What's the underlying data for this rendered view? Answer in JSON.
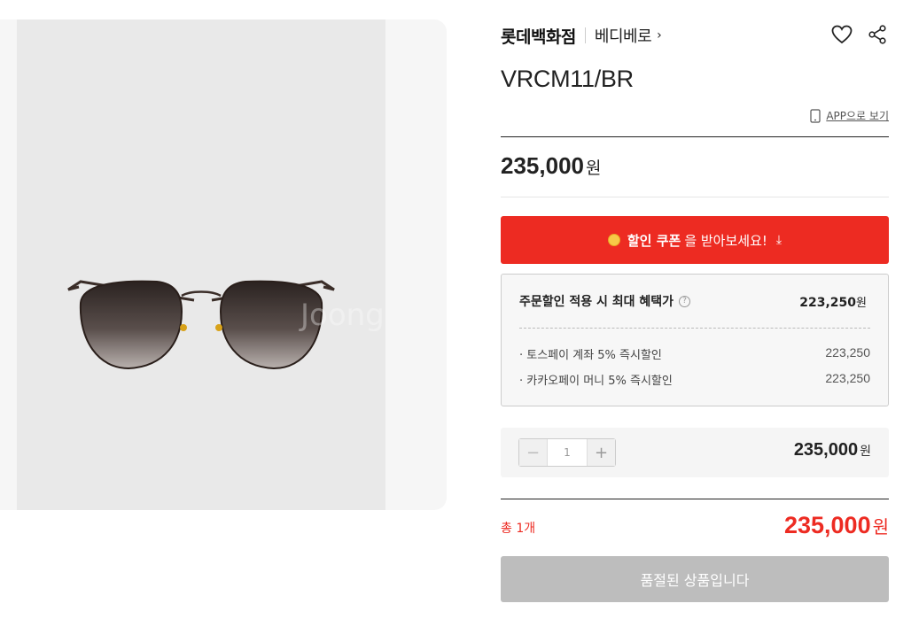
{
  "product": {
    "store_name": "롯데백화점",
    "brand_name": "베디베로",
    "brand_chevron": "›",
    "name": "VRCM11/BR",
    "image_watermark": "Joongang Global"
  },
  "header": {
    "app_view_label": "APP으로 보기",
    "wishlist_icon": "heart-icon",
    "share_icon": "share-icon"
  },
  "price": {
    "amount": "235,000",
    "unit": "원"
  },
  "coupon": {
    "prefix_bold": "할인 쿠폰",
    "suffix": "을 받아보세요!",
    "download_glyph": "⤓"
  },
  "benefit": {
    "title": "주문할인 적용 시 최대 혜택가",
    "help_glyph": "?",
    "total_amount": "223,250",
    "total_unit": "원",
    "rows": [
      {
        "label": "· 토스페이 계좌 5% 즉시할인",
        "value": "223,250"
      },
      {
        "label": "· 카카오페이 머니 5% 즉시할인",
        "value": "223,250"
      }
    ]
  },
  "quantity": {
    "minus": "−",
    "value": "1",
    "plus": "+",
    "line_price": "235,000",
    "line_unit": "원"
  },
  "total": {
    "count_label": "총 1개",
    "amount": "235,000",
    "unit": "원"
  },
  "buy_button": {
    "label": "품절된 상품입니다"
  },
  "colors": {
    "accent_red": "#ed2b22",
    "disabled_gray": "#bdbdbd"
  }
}
